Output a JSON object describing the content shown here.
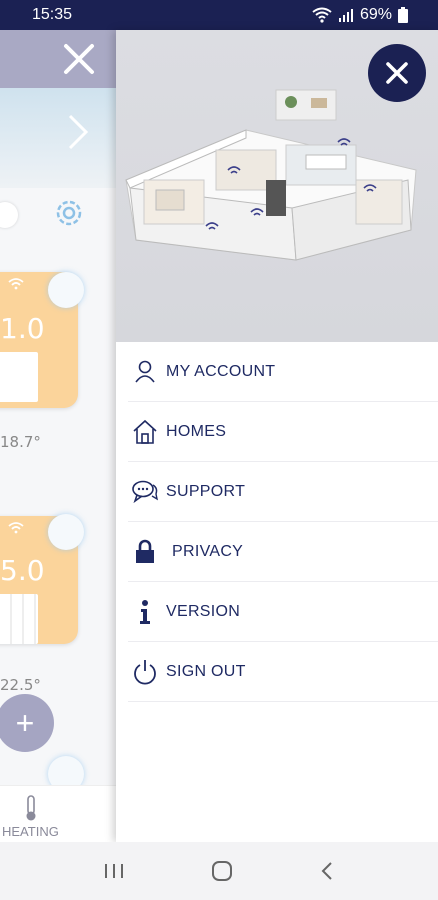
{
  "status_bar": {
    "time": "15:35",
    "battery": "69%"
  },
  "background_app": {
    "card_1_temp": "1.0",
    "card_1_reading": "18.7°",
    "card_2_temp": "5.0",
    "card_2_reading": "22.5°",
    "add_button": "+",
    "bottom_tab_label": "HEATING"
  },
  "drawer": {
    "menu_items": [
      {
        "label": "MY ACCOUNT",
        "icon": "user-icon"
      },
      {
        "label": "HOMES",
        "icon": "home-icon"
      },
      {
        "label": "SUPPORT",
        "icon": "chat-icon"
      },
      {
        "label": "PRIVACY",
        "icon": "lock-icon"
      },
      {
        "label": "VERSION",
        "icon": "info-icon"
      },
      {
        "label": "SIGN OUT",
        "icon": "power-icon"
      }
    ]
  },
  "colors": {
    "navy": "#1b2153",
    "menu_text": "#1f2a63",
    "card_orange": "#fbd49b",
    "header_lavender": "#a9a9c4"
  }
}
